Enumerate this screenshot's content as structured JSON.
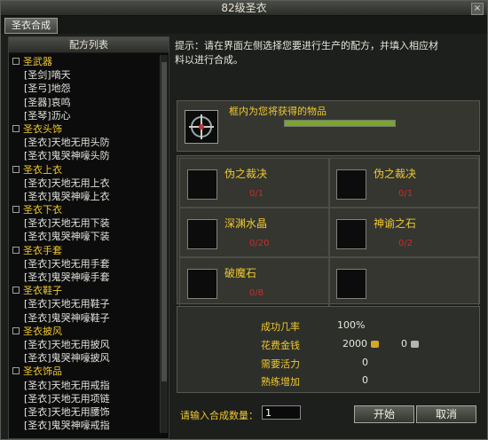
{
  "window": {
    "title": "82级圣衣",
    "close_glyph": "×"
  },
  "tab": {
    "label": "圣衣合成"
  },
  "left": {
    "header": "配方列表",
    "tree": [
      {
        "category": "圣武器",
        "items": [
          "[圣剑]嘀天",
          "[圣弓]地怨",
          "[圣器]哀鸣",
          "[圣琴]沥心"
        ]
      },
      {
        "category": "圣衣头饰",
        "items": [
          "[圣衣]天地无用头防",
          "[圣衣]鬼哭神嚎头防"
        ]
      },
      {
        "category": "圣衣上衣",
        "items": [
          "[圣衣]天地无用上衣",
          "[圣衣]鬼哭神嚎上衣"
        ]
      },
      {
        "category": "圣衣下衣",
        "items": [
          "[圣衣]天地无用下装",
          "[圣衣]鬼哭神嚎下装"
        ]
      },
      {
        "category": "圣衣手套",
        "items": [
          "[圣衣]天地无用手套",
          "[圣衣]鬼哭神嚎手套"
        ]
      },
      {
        "category": "圣衣鞋子",
        "items": [
          "[圣衣]天地无用鞋子",
          "[圣衣]鬼哭神嚎鞋子"
        ]
      },
      {
        "category": "圣衣披风",
        "items": [
          "[圣衣]天地无用披风",
          "[圣衣]鬼哭神嚎披风"
        ]
      },
      {
        "category": "圣衣饰品",
        "items": [
          "[圣衣]天地无用戒指",
          "[圣衣]天地无用项链",
          "[圣衣]天地无用腰饰",
          "[圣衣]鬼哭神嚎戒指"
        ]
      }
    ]
  },
  "hint": {
    "line1": "提示：请在界面左侧选择您要进行生产的配方，并填入相应材",
    "line2": "料以进行合成。"
  },
  "result": {
    "label": "框内为您将获得的物品",
    "progress": 1.0
  },
  "materials": [
    {
      "name": "伪之裁决",
      "count": "0/1"
    },
    {
      "name": "伪之裁决",
      "count": "0/1"
    },
    {
      "name": "深渊水晶",
      "count": "0/20"
    },
    {
      "name": "神谕之石",
      "count": "0/2"
    },
    {
      "name": "破魔石",
      "count": "0/8"
    },
    {
      "name": "",
      "count": ""
    }
  ],
  "stats": {
    "success_label": "成功几率",
    "success_value": "100%",
    "gold_label": "花费金钱",
    "gold_value": "2000",
    "silver_value": "0",
    "energy_label": "需要活力",
    "energy_value": "0",
    "skill_label": "熟练增加",
    "skill_value": "0"
  },
  "bottom": {
    "qty_label": "请输入合成数量：",
    "qty_value": "1",
    "start_label": "开始",
    "cancel_label": "取消"
  },
  "colors": {
    "accent_gold": "#f0c830",
    "count_red": "#d02a2a",
    "progress_green": "#7aa62a"
  }
}
